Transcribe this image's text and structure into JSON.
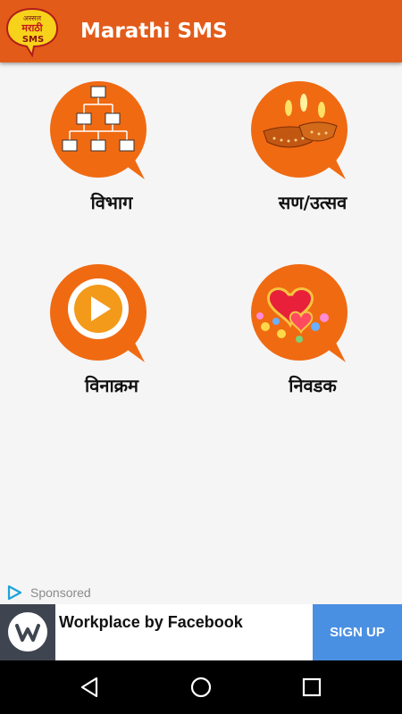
{
  "app": {
    "title": "Marathi SMS",
    "logo_text": [
      "अस्सल",
      "मराठी",
      "SMS"
    ]
  },
  "menu": [
    {
      "label": "विभाग",
      "icon": "hierarchy-icon"
    },
    {
      "label": "सण/उत्सव",
      "icon": "diya-lamp-icon"
    },
    {
      "label": "विनाक्रम",
      "icon": "play-icon"
    },
    {
      "label": "निवडक",
      "icon": "hearts-flowers-icon"
    }
  ],
  "ad": {
    "sponsored_label": "Sponsored",
    "title": "Workplace by Facebook",
    "cta_label": "SIGN UP"
  },
  "colors": {
    "appbar": "#e35b19",
    "tile_orange": "#f06a12",
    "cta_blue": "#4a90e2",
    "background": "#f5f5f5"
  },
  "navbar": {
    "buttons": [
      "back-icon",
      "home-icon",
      "recents-icon"
    ]
  }
}
